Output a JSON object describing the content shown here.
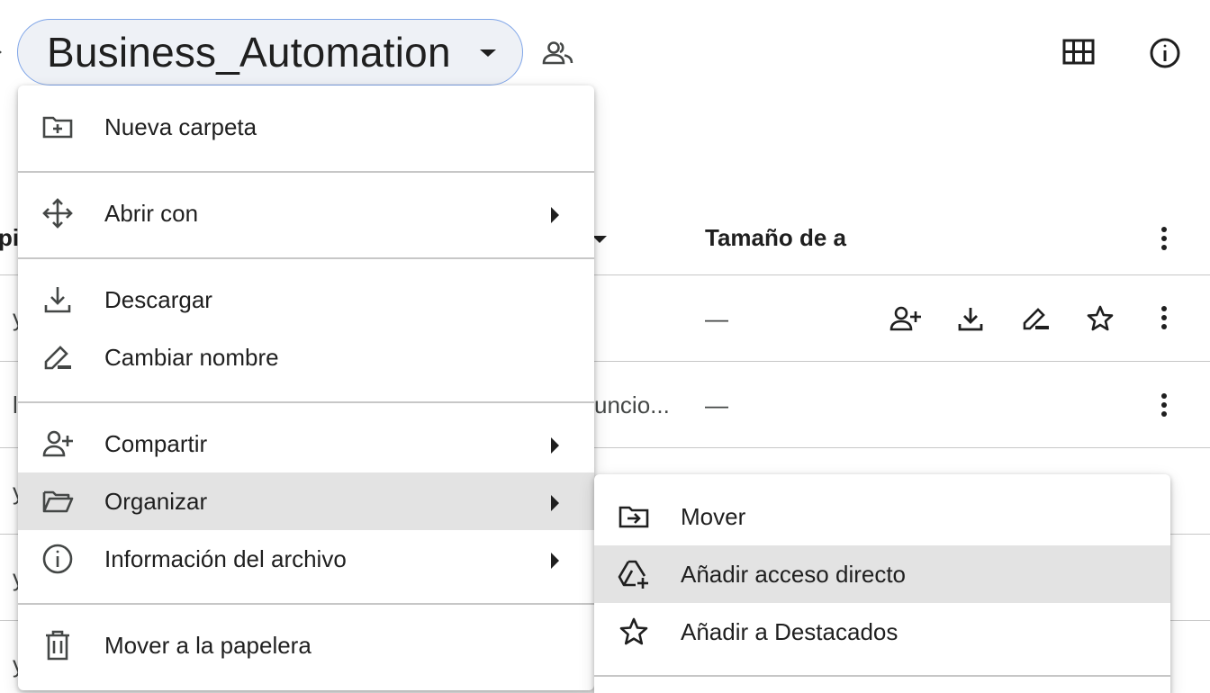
{
  "header": {
    "folder_name": "Business_Automation"
  },
  "table": {
    "column_size_header": "Tamaño de a",
    "column_cut_left": "pi",
    "rows": [
      {
        "size": "—"
      },
      {
        "size": "—",
        "truncated_text": "uncio..."
      }
    ],
    "left_fragments": [
      "y",
      "l",
      "y",
      "y",
      "y"
    ]
  },
  "context_menu": {
    "new_folder": "Nueva carpeta",
    "open_with": "Abrir con",
    "download": "Descargar",
    "rename": "Cambiar nombre",
    "share": "Compartir",
    "organize": "Organizar",
    "file_info": "Información del archivo",
    "trash": "Mover a la papelera"
  },
  "submenu": {
    "move": "Mover",
    "add_shortcut": "Añadir acceso directo",
    "add_starred": "Añadir a Destacados"
  },
  "colors": {
    "chip_border": "#7fa5e8",
    "chip_bg": "#eef1f6",
    "hover_bg": "#e3e3e3",
    "divider": "#c7c7c7",
    "text": "#1f1f1f"
  }
}
